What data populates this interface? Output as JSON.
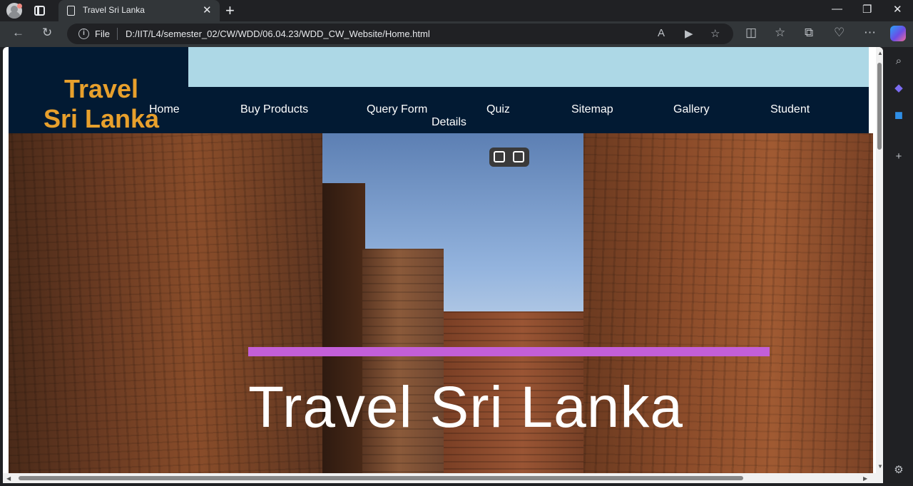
{
  "browser": {
    "tab_title": "Travel Sri Lanka",
    "file_label": "File",
    "url": "D:/IIT/L4/semester_02/CW/WDD/06.04.23/WDD_CW_Website/Home.html"
  },
  "logo": {
    "line1": "Travel",
    "line2": "Sri Lanka"
  },
  "nav": {
    "items": [
      {
        "label": "Home"
      },
      {
        "label": "Buy Products"
      },
      {
        "label": "Query Form"
      },
      {
        "label": "Details"
      },
      {
        "label": "Quiz"
      },
      {
        "label": "Sitemap"
      },
      {
        "label": "Gallery"
      },
      {
        "label": "Student"
      }
    ]
  },
  "hero": {
    "title": "Travel Sri Lanka"
  },
  "colors": {
    "nav_bg": "#021a33",
    "top_band": "#add8e6",
    "logo_text": "#e8a02c",
    "accent_bar": "#c35fd8"
  }
}
